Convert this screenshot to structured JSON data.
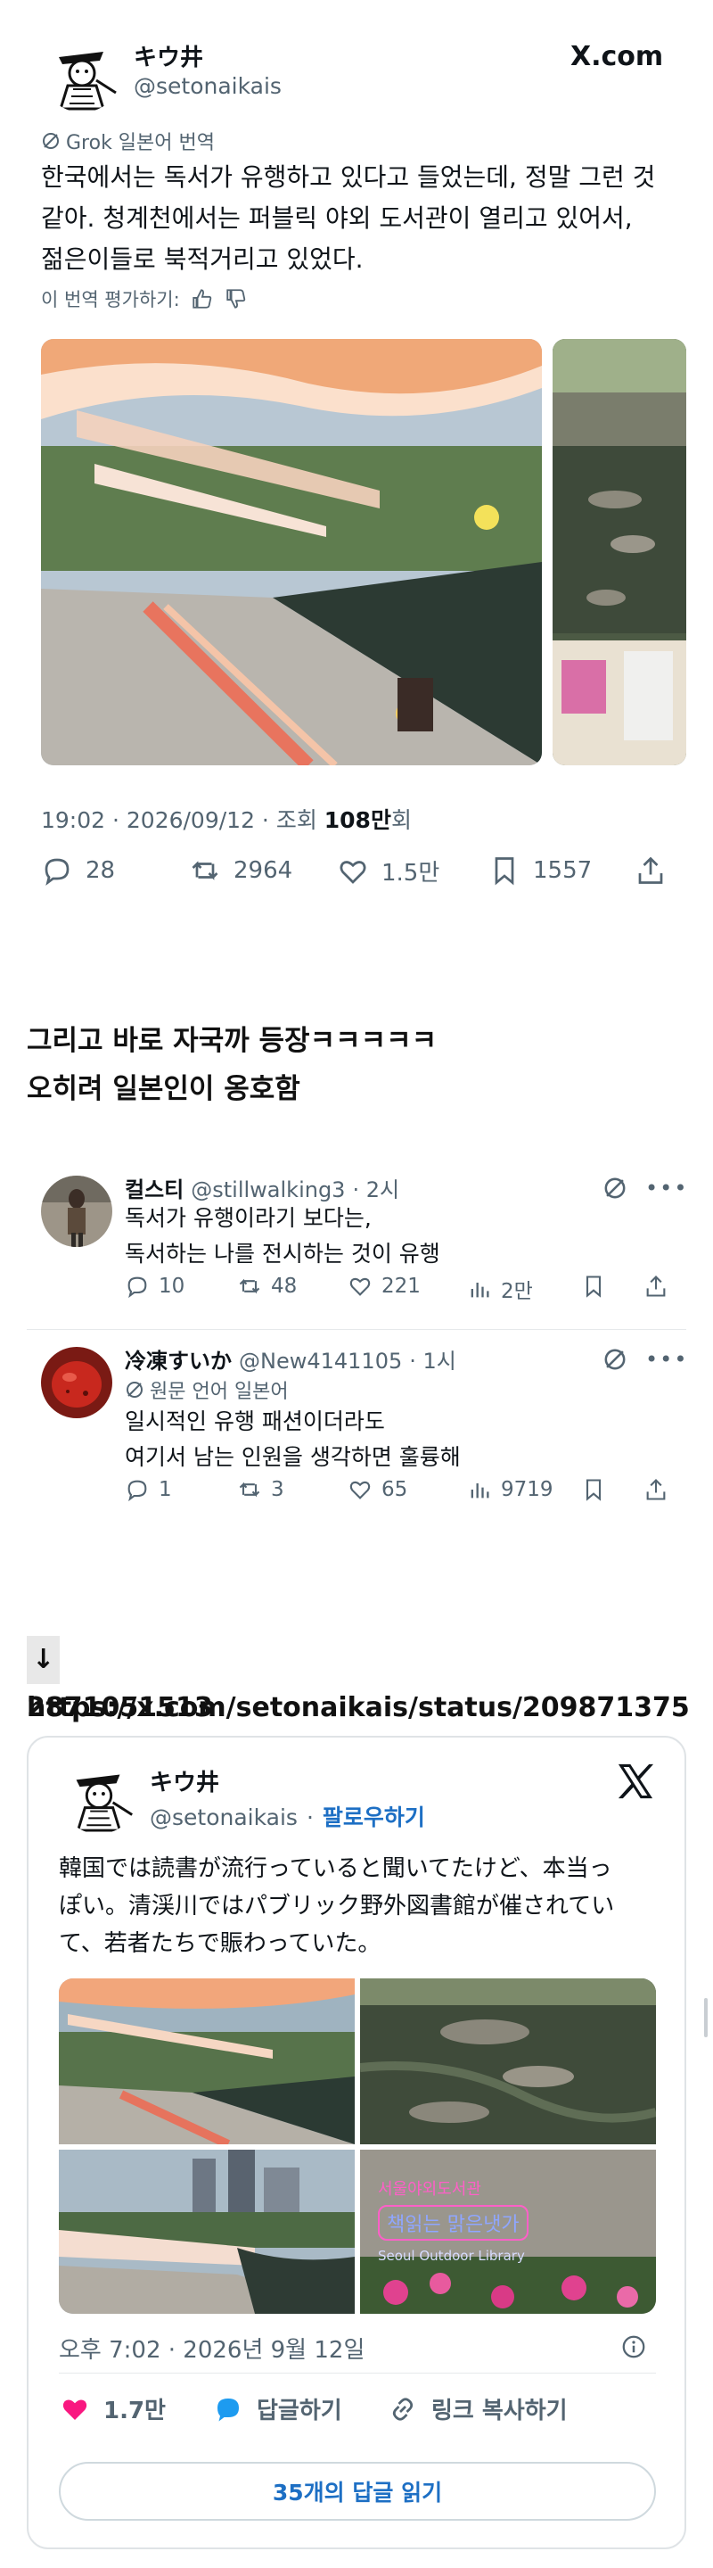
{
  "tweet": {
    "name": "キウ井",
    "handle": "@setonaikais",
    "site": "X.com",
    "grok_label": "Grok 일본어 번역",
    "text": "한국에서는 독서가 유행하고 있다고 들었는데, 정말 그런 것\n같아. 청계천에서는 퍼블릭 야외 도서관이 열리고 있어서,\n젊은이들로 북적거리고 있었다.",
    "rate_label": "이 번역 평가하기:",
    "meta_prefix": "19:02 · 2026/09/12 · 조회 ",
    "views": "108만",
    "views_suffix": "회",
    "replies": "28",
    "reposts": "2964",
    "likes": "1.5만",
    "bookmarks": "1557"
  },
  "commentary": {
    "line1": "그리고 바로 자국까 등장ㅋㅋㅋㅋㅋ",
    "line2": "오히려 일본인이 옹호함"
  },
  "replies": [
    {
      "name": "컬스티",
      "handle": "@stillwalking3",
      "time": "· 2시",
      "text": "독서가 유행이라기 보다는,\n독서하는 나를 전시하는 것이 유행",
      "replies": "10",
      "reposts": "48",
      "likes": "221",
      "views": "2만"
    },
    {
      "name": "冷凍すいか",
      "handle": "@New4141105",
      "time": "· 1시",
      "lang_label": "원문 언어 일본어",
      "text": "일시적인 유행 패션이더라도\n여기서 남는 인원을 생각하면 훌륭해",
      "replies": "1",
      "reposts": "3",
      "likes": "65",
      "views": "9719"
    }
  ],
  "link": {
    "arrow": "↓",
    "line1": "https://x.com/setonaikais/status/209871375",
    "line2": "2871051513"
  },
  "embed": {
    "name": "キウ井",
    "handle": "@setonaikais",
    "follow": "팔로우하기",
    "text": "韓国では読書が流行っていると聞いてたけど、本当っ\nぽい。清渓川ではパブリック野外図書館が催されてい\nて、若者たちで賑わっていた。",
    "sign_line1": "서울야외도서관",
    "sign_line2": "책읽는 맑은냇가",
    "sign_line3": "Seoul Outdoor Library",
    "date": "오후 7:02 · 2026년 9월 12일",
    "likes": "1.7만",
    "reply_label": "답글하기",
    "copy_label": "링크 복사하기",
    "read_replies": "35개의 답글 읽기"
  },
  "colors": {
    "text": "#0f1419",
    "muted": "#536471",
    "link_blue": "#1d6fc4",
    "heart": "#f91880",
    "reply_blue": "#1d9bf0"
  }
}
